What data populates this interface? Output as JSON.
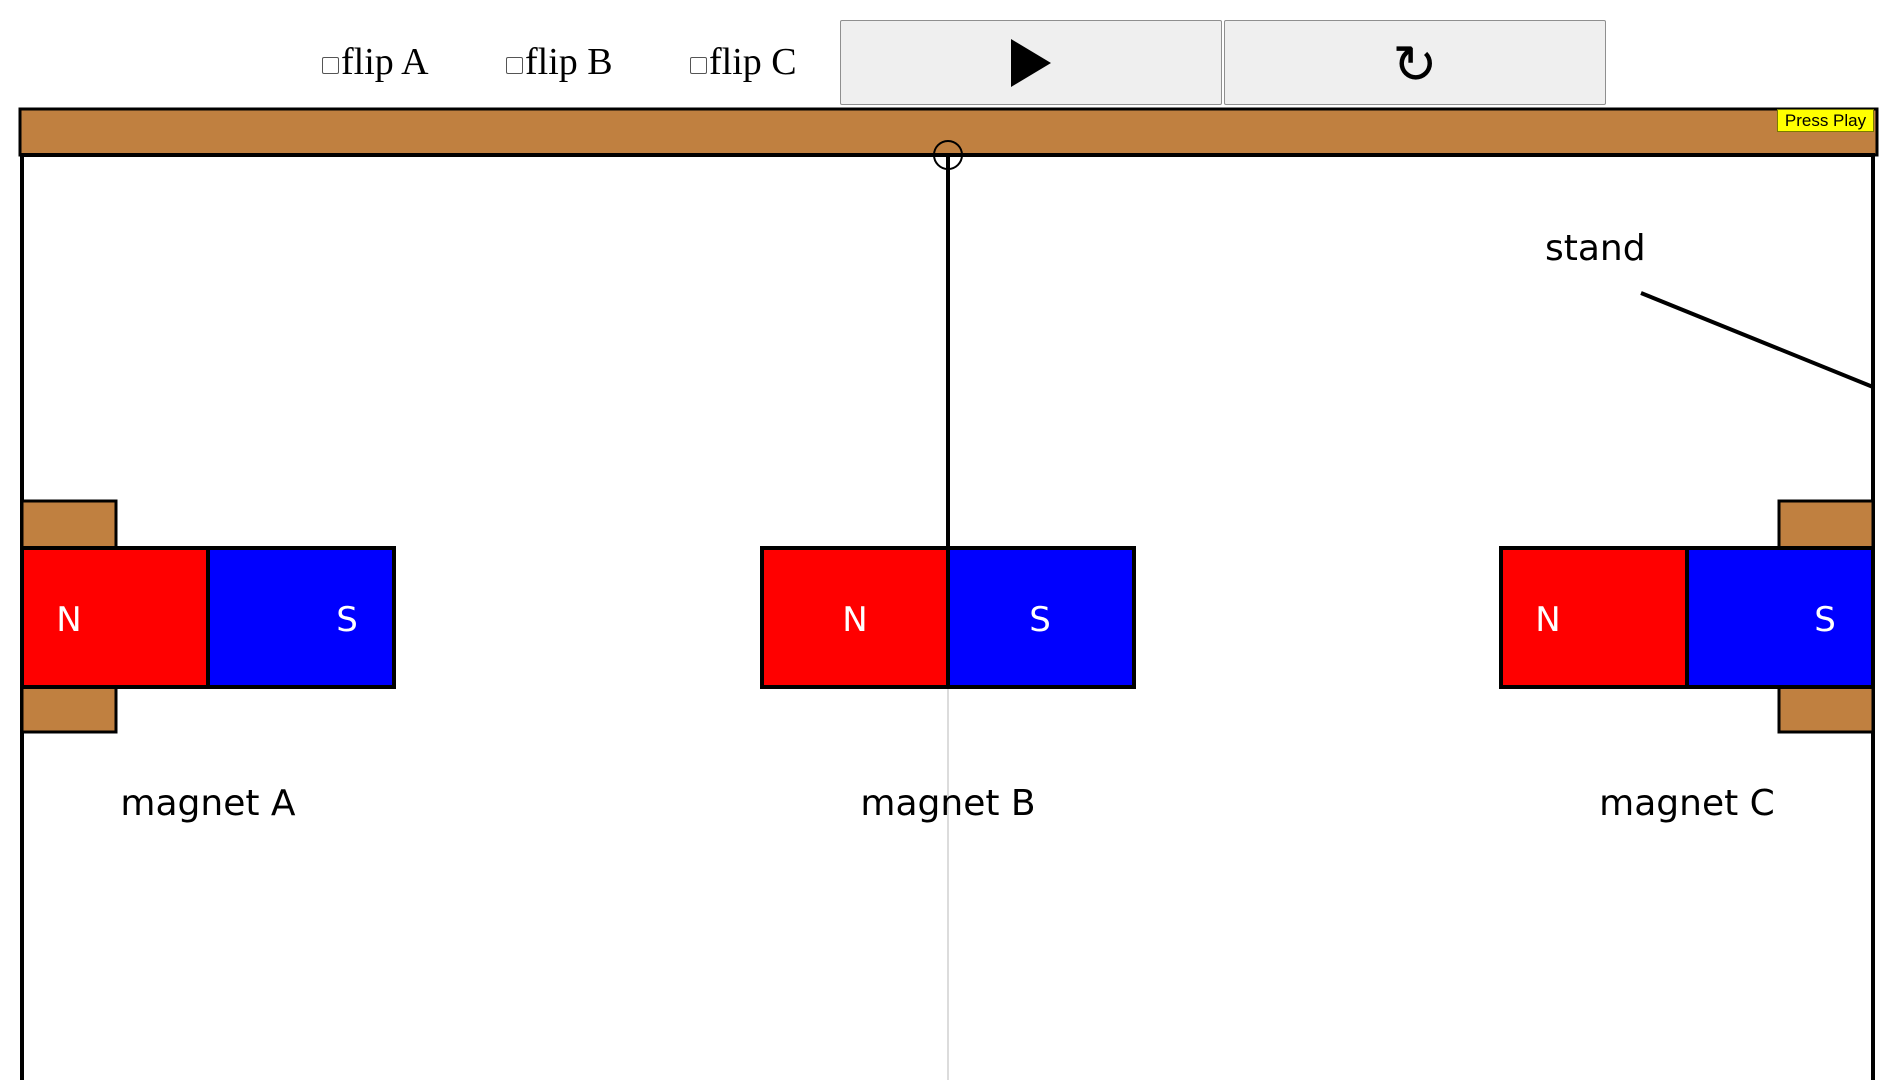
{
  "controls": {
    "flip_a": {
      "label": "flip A",
      "checked": false
    },
    "flip_b": {
      "label": "flip B",
      "checked": false
    },
    "flip_c": {
      "label": "flip C",
      "checked": false
    },
    "play_icon": "play-triangle",
    "reset_icon": "↻"
  },
  "status": "Press Play",
  "scene": {
    "stand_label": "stand",
    "magnets": [
      {
        "label": "magnet A",
        "north": "N",
        "south": "S"
      },
      {
        "label": "magnet B",
        "north": "N",
        "south": "S"
      },
      {
        "label": "magnet C",
        "north": "N",
        "south": "S"
      }
    ]
  },
  "colors": {
    "north": "#ff0000",
    "south": "#0000ff",
    "stand": "#c08040",
    "button_bg": "#efefef",
    "status_bg": "#ffff00"
  }
}
